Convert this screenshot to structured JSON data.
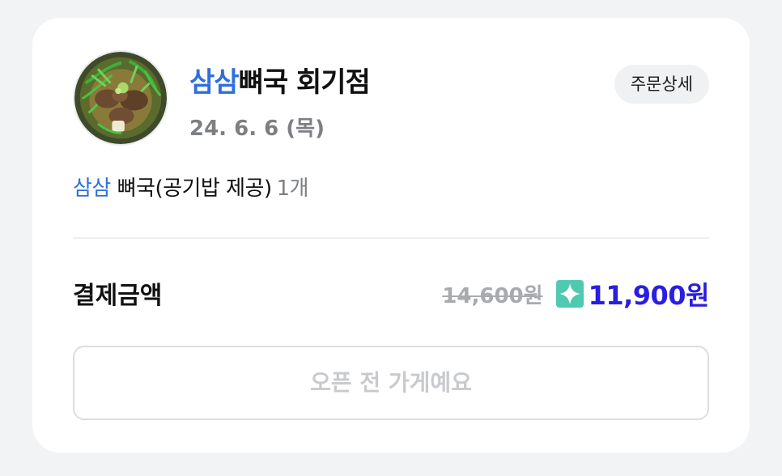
{
  "order": {
    "store_name_highlight": "삼삼",
    "store_name_rest": "뼈국 회기점",
    "date": "24. 6. 6 (목)",
    "detail_button": "주문상세",
    "menu_highlight": "삼삼",
    "menu_rest": " 뼈국(공기밥 제공)",
    "menu_qty": "1개",
    "payment_label": "결제금액",
    "original_price": "14,600원",
    "final_price": "11,900원",
    "status_button": "오픈 전 가게예요",
    "thumbnail_icon": "food-photo",
    "discount_icon": "sparkle-badge-icon"
  },
  "colors": {
    "highlight": "#2f6fdc",
    "final_price": "#2a1ee0",
    "badge": "#4fc9b0"
  }
}
